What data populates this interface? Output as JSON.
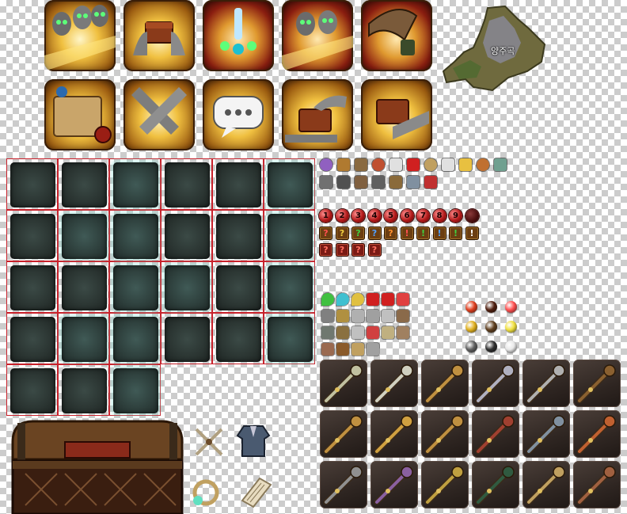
{
  "minimap": {
    "label": "양주곡"
  },
  "top_icons_row1": [
    {
      "icon": "spirit-faces-icon",
      "variant": "gold"
    },
    {
      "icon": "hands-holding-box-icon",
      "variant": "gold"
    },
    {
      "icon": "exclamation-burst-icon",
      "variant": "red"
    },
    {
      "icon": "spirit-faces-icon",
      "variant": "red"
    },
    {
      "icon": "drum-horn-icon",
      "variant": "red"
    }
  ],
  "top_icons_row2": [
    {
      "icon": "scroll-map-icon",
      "variant": "gold"
    },
    {
      "icon": "handshake-icon",
      "variant": "gold"
    },
    {
      "icon": "chat-bubble-icon",
      "variant": "gold"
    },
    {
      "icon": "hand-on-box-icon",
      "variant": "gold"
    },
    {
      "icon": "give-box-icon",
      "variant": "gold"
    }
  ],
  "slot_grid": {
    "rows": 5,
    "cols": 6,
    "last_row_count": 3,
    "glow_slots": [
      2,
      5,
      7,
      8,
      11,
      14,
      15,
      17,
      19,
      20,
      23,
      26,
      28
    ],
    "border_color": "#c8202a"
  },
  "numbered_markers": [
    "1",
    "2",
    "3",
    "4",
    "5",
    "6",
    "7",
    "8",
    "9",
    ""
  ],
  "quest_markers_row1": [
    "?",
    "?",
    "?",
    "?",
    "?",
    "!",
    "!",
    "!",
    "!",
    "!"
  ],
  "quest_markers_row1_colors": [
    "#ff5050",
    "#f0d040",
    "#40d040",
    "#50a0ff",
    "#ff9030",
    "#ff5050",
    "#40d040",
    "#50a0ff",
    "#40d040",
    "#ffffff"
  ],
  "quest_markers_row2": [
    "?",
    "?",
    "?",
    "?"
  ],
  "weapons": [
    "spear-icon",
    "sword-icon",
    "blade-icon",
    "shuriken-icon",
    "claw-icon",
    "bow-icon",
    "scepter-icon",
    "fan-icon",
    "lantern-mace-icon",
    "chakram-icon",
    "hammer-icon",
    "staff-bow-icon",
    "pole-mace-icon",
    "trident-icon",
    "golden-mace-icon",
    "axe-icon",
    "ornate-staff-icon",
    "wand-icon"
  ],
  "orb_colors": [
    "#e04020",
    "#502010",
    "#ff5050",
    "#e0b020",
    "#604020",
    "#f0e040",
    "#606060",
    "#303030",
    "#e8e8e8"
  ]
}
